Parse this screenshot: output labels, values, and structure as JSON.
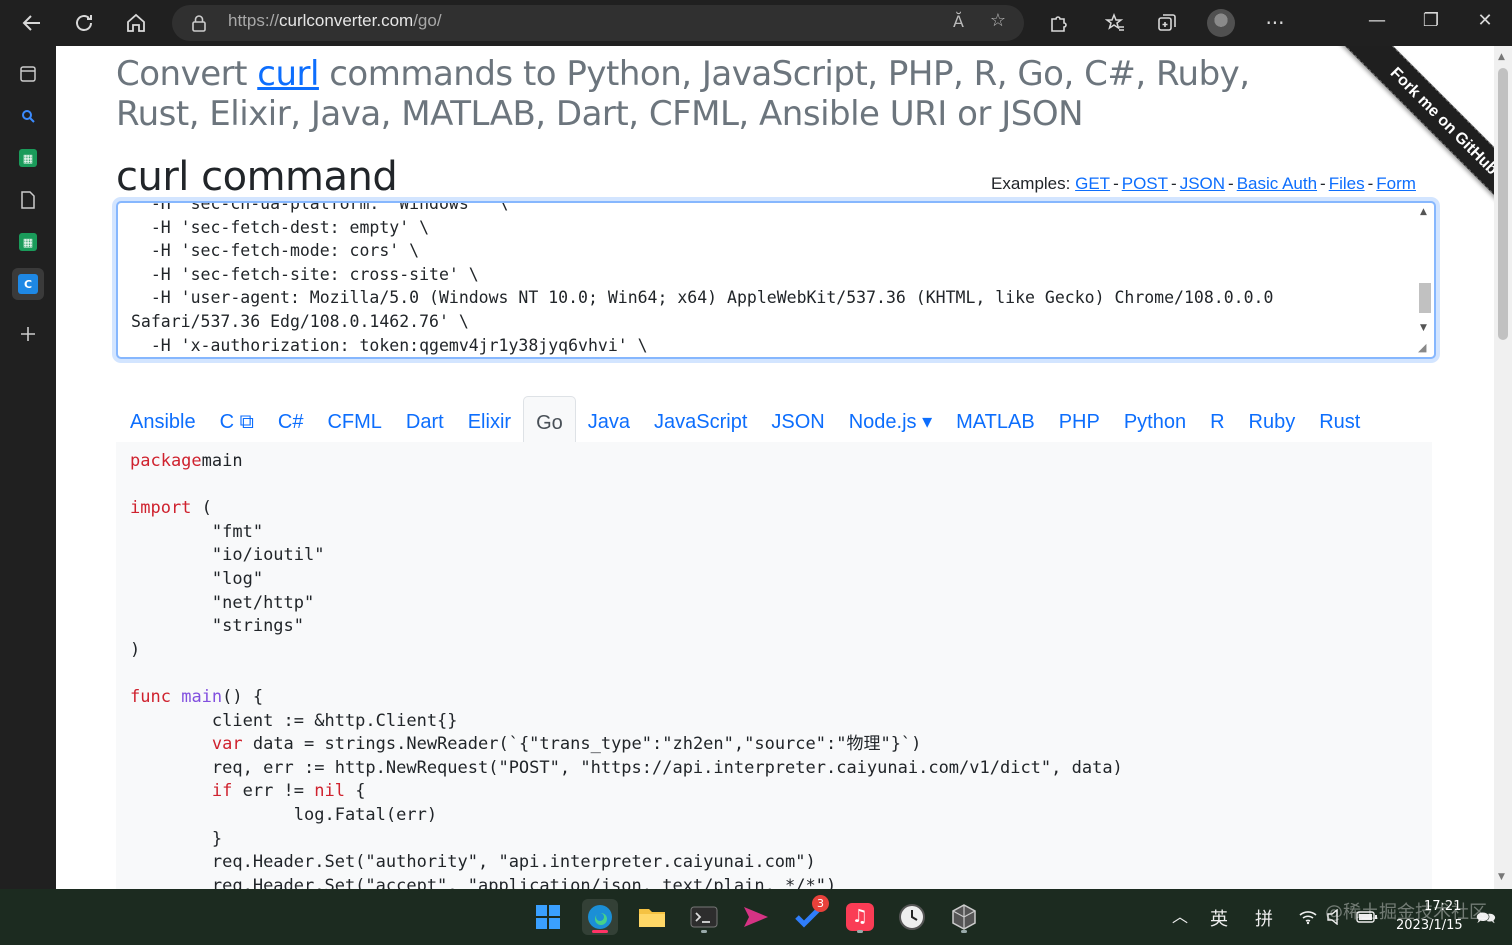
{
  "browser": {
    "url_scheme": "https://",
    "url_host": "curlconverter.com",
    "url_path": "/go/",
    "read_aloud_icon": "Ă",
    "menu_label": "···"
  },
  "page": {
    "headline_prefix": "Convert ",
    "headline_link": "curl",
    "headline_suffix": " commands to Python, JavaScript, PHP, R, Go, C#, Ruby, Rust, Elixir, Java, MATLAB, Dart, CFML, Ansible URI or JSON",
    "section_title": "curl command",
    "examples_label": "Examples:",
    "examples": [
      "GET",
      "POST",
      "JSON",
      "Basic Auth",
      "Files",
      "Form"
    ],
    "ribbon": "Fork me on GitHub"
  },
  "curl_input": "  -H 'sec-ch-ua-platform: \"Windows\"' \\\n  -H 'sec-fetch-dest: empty' \\\n  -H 'sec-fetch-mode: cors' \\\n  -H 'sec-fetch-site: cross-site' \\\n  -H 'user-agent: Mozilla/5.0 (Windows NT 10.0; Win64; x64) AppleWebKit/537.36 (KHTML, like Gecko) Chrome/108.0.0.0\nSafari/537.36 Edg/108.0.1462.76' \\\n  -H 'x-authorization: token:qgemv4jr1y38jyq6vhvi' \\",
  "tabs": [
    {
      "label": "Ansible",
      "active": false
    },
    {
      "label": "C ⧉",
      "active": false
    },
    {
      "label": "C#",
      "active": false
    },
    {
      "label": "CFML",
      "active": false
    },
    {
      "label": "Dart",
      "active": false
    },
    {
      "label": "Elixir",
      "active": false
    },
    {
      "label": "Go",
      "active": true
    },
    {
      "label": "Java",
      "active": false
    },
    {
      "label": "JavaScript",
      "active": false
    },
    {
      "label": "JSON",
      "active": false
    },
    {
      "label": "Node.js ▾",
      "active": false
    },
    {
      "label": "MATLAB",
      "active": false
    },
    {
      "label": "PHP",
      "active": false
    },
    {
      "label": "Python",
      "active": false
    },
    {
      "label": "R",
      "active": false
    },
    {
      "label": "Ruby",
      "active": false
    },
    {
      "label": "Rust",
      "active": false
    }
  ],
  "code_lines": [
    [
      [
        "kw",
        "package"
      ],
      [
        "",
        "main"
      ]
    ],
    [],
    [
      [
        "kw",
        "import"
      ],
      [
        "",
        " ("
      ]
    ],
    [
      [
        "",
        "\t\"fmt\""
      ]
    ],
    [
      [
        "",
        "\t\"io/ioutil\""
      ]
    ],
    [
      [
        "",
        "\t\"log\""
      ]
    ],
    [
      [
        "",
        "\t\"net/http\""
      ]
    ],
    [
      [
        "",
        "\t\"strings\""
      ]
    ],
    [
      [
        "",
        ")"
      ]
    ],
    [],
    [
      [
        "kw",
        "func"
      ],
      [
        "",
        " "
      ],
      [
        "fn",
        "main"
      ],
      [
        "",
        "() {"
      ]
    ],
    [
      [
        "",
        "\tclient := &http.Client{}"
      ]
    ],
    [
      [
        "",
        "\t"
      ],
      [
        "kw",
        "var"
      ],
      [
        "",
        " data = strings.NewReader(`{\"trans_type\":\"zh2en\",\"source\":\"物理\"}`)"
      ]
    ],
    [
      [
        "",
        "\treq, err := http.NewRequest(\"POST\", \"https://api.interpreter.caiyunai.com/v1/dict\", data)"
      ]
    ],
    [
      [
        "",
        "\t"
      ],
      [
        "kw",
        "if"
      ],
      [
        "",
        " err != "
      ],
      [
        "kw",
        "nil"
      ],
      [
        "",
        " {"
      ]
    ],
    [
      [
        "",
        "\t\tlog.Fatal(err)"
      ]
    ],
    [
      [
        "",
        "\t}"
      ]
    ],
    [
      [
        "",
        "\treq.Header.Set(\"authority\", \"api.interpreter.caiyunai.com\")"
      ]
    ],
    [
      [
        "",
        "\treq.Header.Set(\"accept\", \"application/json, text/plain, */*\")"
      ]
    ]
  ],
  "taskbar": {
    "todo_badge": "3",
    "ime_lang": "英",
    "ime_mode": "拼",
    "time": "17:21",
    "date": "2023/1/15",
    "watermark": "@稀土掘金技术社区"
  },
  "colors": {
    "link": "#0d6efd",
    "keyword": "#cf222e",
    "function": "#8250df"
  }
}
